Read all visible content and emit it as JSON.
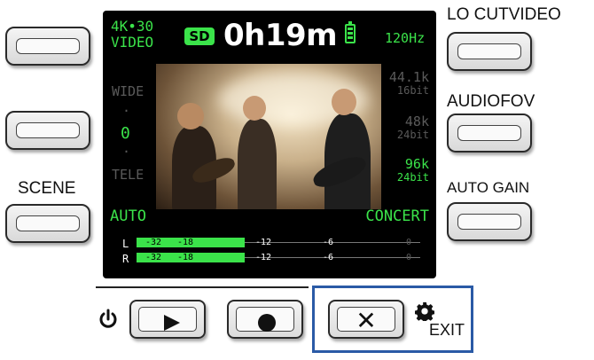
{
  "left_buttons": {
    "scene_label": "SCENE"
  },
  "right_buttons": {
    "lo_cut_label": "LO CUT",
    "video_label": "VIDEO",
    "audio_label": "AUDIO",
    "fov_label": "FOV",
    "auto_gain_label": "AUTO GAIN"
  },
  "screen": {
    "video_format_line1": "4K•30",
    "video_format_line2": "VIDEO",
    "sd_badge": "SD",
    "remaining_time": "0h19m",
    "frame_rate": "120Hz",
    "zoom": {
      "wide": "WIDE",
      "dot": "·",
      "value": "0",
      "tele": "TELE"
    },
    "audio_options": [
      {
        "rate": "44.1k",
        "bits": "16bit"
      },
      {
        "rate": "48k",
        "bits": "24bit"
      },
      {
        "rate": "96k",
        "bits": "24bit"
      }
    ],
    "scene_value": "AUTO",
    "sound_value": "CONCERT",
    "meter": {
      "left_channel": "L",
      "right_channel": "R",
      "ticks": [
        "-32",
        "-18",
        "-12",
        "-6",
        "0"
      ],
      "left_level_fraction": 0.38,
      "right_level_fraction": 0.38
    }
  },
  "bottom_buttons": {
    "exit_label": "EXIT"
  },
  "icons": {
    "power": "power-icon",
    "play": "play-icon",
    "record": "record-icon",
    "exit": "close-icon",
    "settings": "gear-icon"
  },
  "colors": {
    "screen_green": "#3be34a",
    "exit_highlight": "#2a5aa6"
  }
}
